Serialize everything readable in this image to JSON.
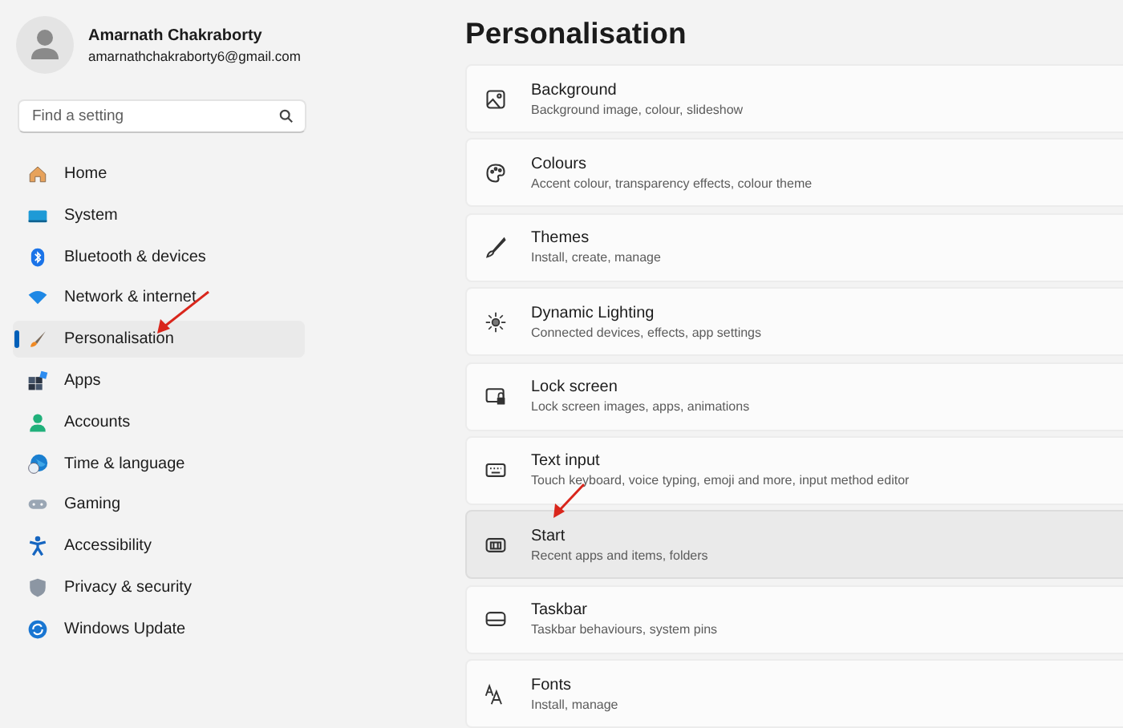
{
  "account": {
    "name": "Amarnath Chakraborty",
    "email": "amarnathchakraborty6@gmail.com"
  },
  "search": {
    "placeholder": "Find a setting"
  },
  "nav": [
    {
      "label": "Home",
      "selected": false
    },
    {
      "label": "System",
      "selected": false
    },
    {
      "label": "Bluetooth & devices",
      "selected": false
    },
    {
      "label": "Network & internet",
      "selected": false
    },
    {
      "label": "Personalisation",
      "selected": true
    },
    {
      "label": "Apps",
      "selected": false
    },
    {
      "label": "Accounts",
      "selected": false
    },
    {
      "label": "Time & language",
      "selected": false
    },
    {
      "label": "Gaming",
      "selected": false
    },
    {
      "label": "Accessibility",
      "selected": false
    },
    {
      "label": "Privacy & security",
      "selected": false
    },
    {
      "label": "Windows Update",
      "selected": false
    }
  ],
  "page_title": "Personalisation",
  "settings": [
    {
      "title": "Background",
      "description": "Background image, colour, slideshow",
      "hovered": false
    },
    {
      "title": "Colours",
      "description": "Accent colour, transparency effects, colour theme",
      "hovered": false
    },
    {
      "title": "Themes",
      "description": "Install, create, manage",
      "hovered": false
    },
    {
      "title": "Dynamic Lighting",
      "description": "Connected devices, effects, app settings",
      "hovered": false
    },
    {
      "title": "Lock screen",
      "description": "Lock screen images, apps, animations",
      "hovered": false
    },
    {
      "title": "Text input",
      "description": "Touch keyboard, voice typing, emoji and more, input method editor",
      "hovered": false
    },
    {
      "title": "Start",
      "description": "Recent apps and items, folders",
      "hovered": true
    },
    {
      "title": "Taskbar",
      "description": "Taskbar behaviours, system pins",
      "hovered": false
    },
    {
      "title": "Fonts",
      "description": "Install, manage",
      "hovered": false
    }
  ]
}
